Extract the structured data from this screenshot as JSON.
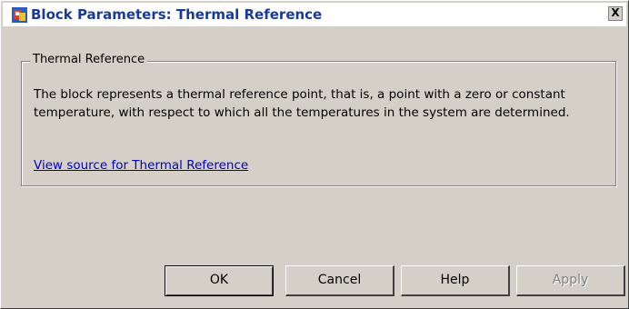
{
  "window": {
    "title": "Block Parameters: Thermal Reference",
    "close_symbol": "X",
    "icon": "simulink-block-icon"
  },
  "group": {
    "label": "Thermal Reference",
    "description": "The block represents a thermal reference point, that is, a point with a zero or constant temperature, with respect to which all the temperatures in the system are determined.",
    "link_text": "View source for Thermal Reference"
  },
  "buttons": {
    "ok": "OK",
    "cancel": "Cancel",
    "help": "Help",
    "apply": "Apply"
  },
  "colors": {
    "title_text": "#1a3a9a",
    "link": "#0000cc",
    "dialog_bg": "#d4d0c8"
  }
}
